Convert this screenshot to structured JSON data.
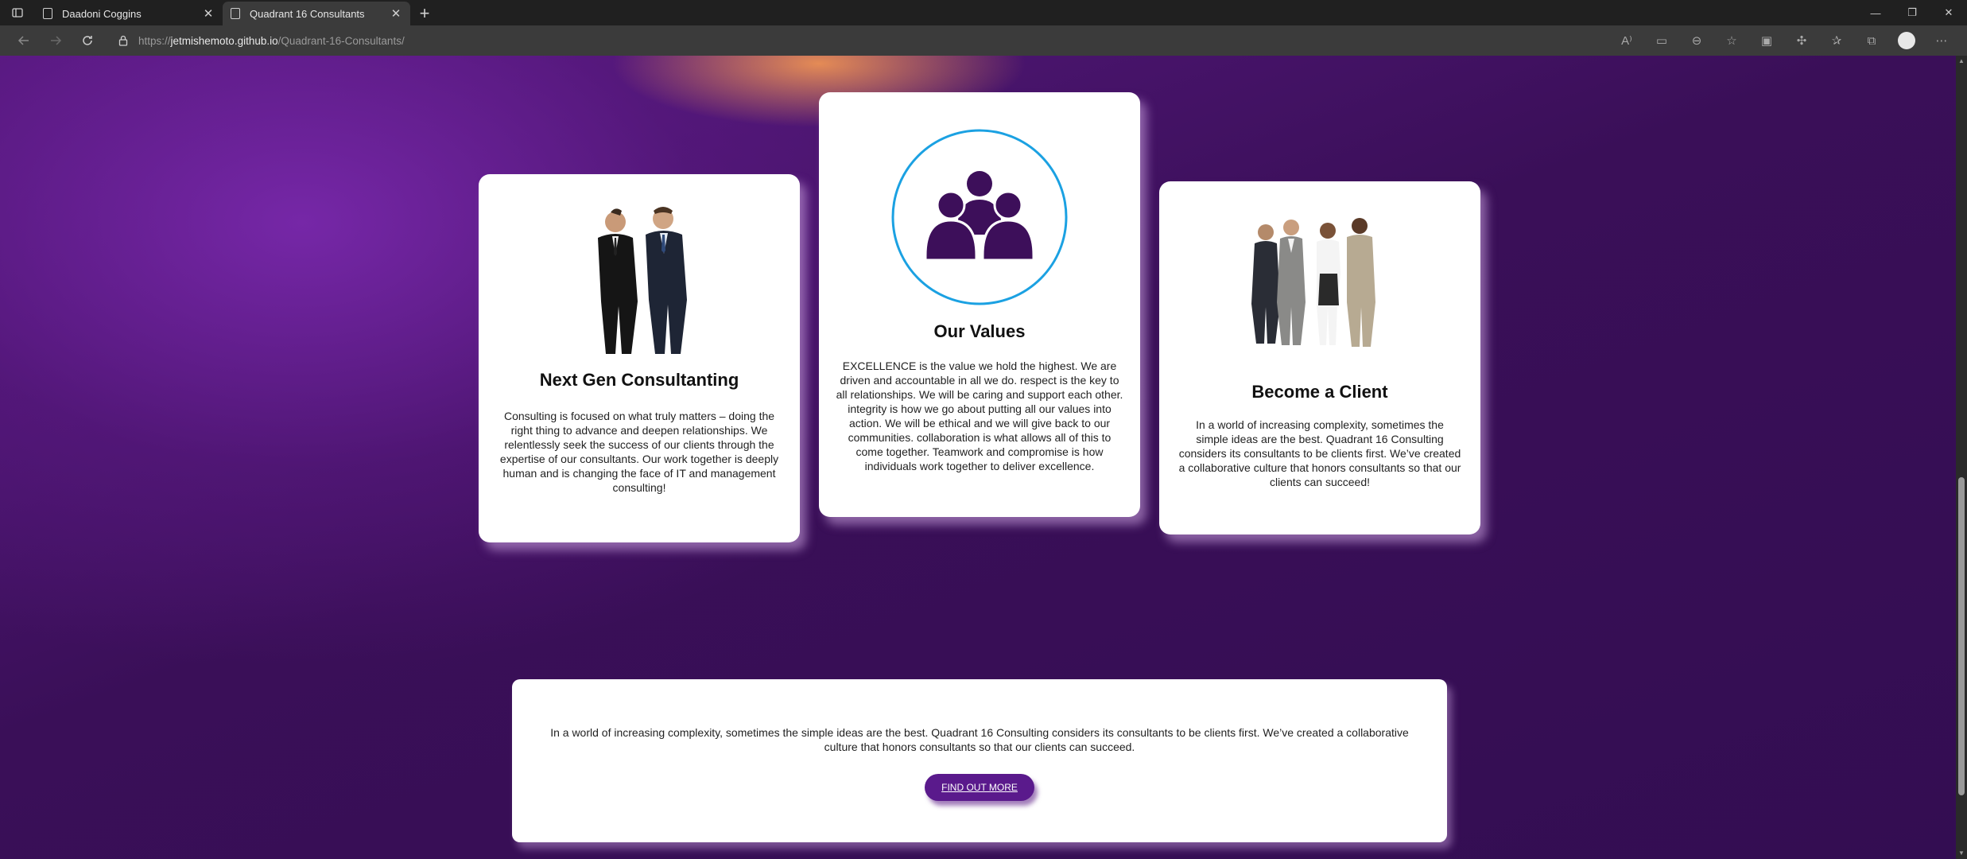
{
  "browser": {
    "tabs": [
      {
        "title": "Daadoni Coggins",
        "active": false
      },
      {
        "title": "Quadrant 16 Consultants",
        "active": true
      }
    ],
    "url": {
      "scheme": "https://",
      "host": "jetmishemoto.github.io",
      "path": "/Quadrant-16-Consultants/"
    }
  },
  "cards": [
    {
      "title": "Next Gen Consultanting",
      "text": "Consulting is focused on what truly matters – doing the right thing to advance and deepen relationships. We relentlessly seek the success of our clients through the expertise of our consultants. Our work together is deeply human and is changing the face of IT and management consulting!",
      "image": "two-businessmen-photo"
    },
    {
      "title": "Our Values",
      "text": "EXCELLENCE is the value we hold the highest. We are driven and accountable in all we do. respect is the key to all relationships. We will be caring and support each other. integrity is how we go about putting all our values into action. We will be ethical and we will give back to our communities. collaboration is what allows all of this to come together. Teamwork and compromise is how individuals work together to deliver excellence.",
      "image": "group-people-icon"
    },
    {
      "title": "Become a Client",
      "text": "In a world of increasing complexity, sometimes the simple ideas are the best. Quadrant 16 Consulting considers its consultants to be clients first. We’ve created a collaborative culture that honors consultants so that our clients can succeed!",
      "image": "business-team-photo"
    }
  ],
  "banner": {
    "text": "In a world of increasing complexity, sometimes the simple ideas are the best. Quadrant 16 Consulting considers its consultants to be clients first. We’ve created a collaborative culture that honors consultants so that our clients can succeed.",
    "button_label": "FIND OUT MORE"
  },
  "colors": {
    "accent": "#5a1a8c",
    "icon_purple": "#3d0f5a",
    "ring_blue": "#1ba1e2"
  }
}
